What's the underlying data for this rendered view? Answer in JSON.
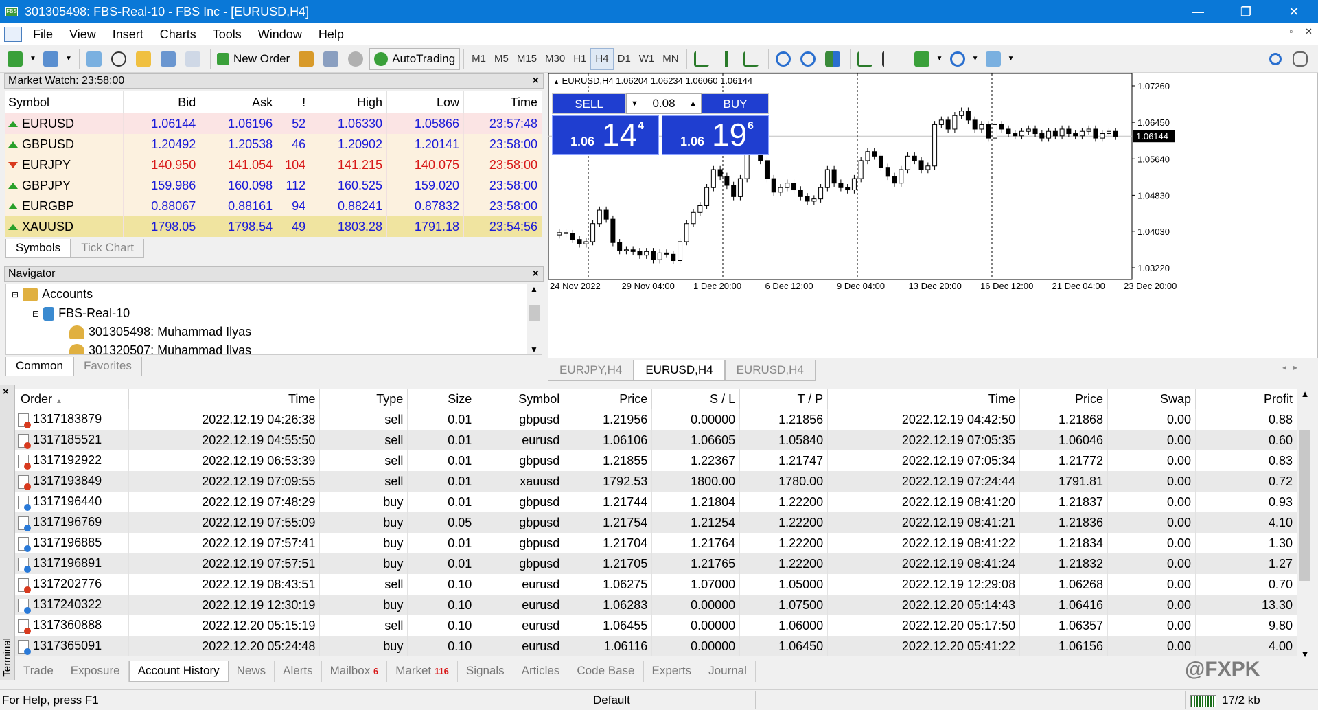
{
  "window": {
    "title": "301305498: FBS-Real-10 - FBS Inc - [EURUSD,H4]",
    "min_icon": "minimize-icon",
    "max_icon": "restore-icon",
    "close_icon": "close-icon",
    "minimize": "—",
    "restore": "❐",
    "close": "✕"
  },
  "menu": {
    "items": [
      "File",
      "View",
      "Insert",
      "Charts",
      "Tools",
      "Window",
      "Help"
    ],
    "mdi": [
      "–",
      "▫",
      "✕"
    ]
  },
  "toolbar": {
    "new_order": "New Order",
    "autotrading": "AutoTrading",
    "timeframes": [
      "M1",
      "M5",
      "M15",
      "M30",
      "H1",
      "H4",
      "D1",
      "W1",
      "MN"
    ],
    "active_timeframe": "H4"
  },
  "market_watch": {
    "title": "Market Watch: 23:58:00",
    "columns": [
      "Symbol",
      "Bid",
      "Ask",
      "!",
      "High",
      "Low",
      "Time"
    ],
    "rows": [
      {
        "symbol": "EURUSD",
        "bid": "1.06144",
        "ask": "1.06196",
        "spread": "52",
        "high": "1.06330",
        "low": "1.05866",
        "time": "23:57:48",
        "dir": "up",
        "bg": "pink"
      },
      {
        "symbol": "GBPUSD",
        "bid": "1.20492",
        "ask": "1.20538",
        "spread": "46",
        "high": "1.20902",
        "low": "1.20141",
        "time": "23:58:00",
        "dir": "up",
        "bg": "cream"
      },
      {
        "symbol": "EURJPY",
        "bid": "140.950",
        "ask": "141.054",
        "spread": "104",
        "high": "141.215",
        "low": "140.075",
        "time": "23:58:00",
        "dir": "down",
        "bg": "cream"
      },
      {
        "symbol": "GBPJPY",
        "bid": "159.986",
        "ask": "160.098",
        "spread": "112",
        "high": "160.525",
        "low": "159.020",
        "time": "23:58:00",
        "dir": "up",
        "bg": "cream"
      },
      {
        "symbol": "EURGBP",
        "bid": "0.88067",
        "ask": "0.88161",
        "spread": "94",
        "high": "0.88241",
        "low": "0.87832",
        "time": "23:58:00",
        "dir": "up",
        "bg": "cream"
      },
      {
        "symbol": "XAUUSD",
        "bid": "1798.05",
        "ask": "1798.54",
        "spread": "49",
        "high": "1803.28",
        "low": "1791.18",
        "time": "23:54:56",
        "dir": "up",
        "bg": "gold"
      }
    ],
    "tabs": [
      "Symbols",
      "Tick Chart"
    ]
  },
  "navigator": {
    "title": "Navigator",
    "accounts": "Accounts",
    "server": "FBS-Real-10",
    "account1": "301305498: Muhammad Ilyas",
    "account2": "301320507: Muhammad Ilyas",
    "tabs": [
      "Common",
      "Favorites"
    ]
  },
  "chart": {
    "header": "EURUSD,H4  1.06204 1.06234 1.06060 1.06144",
    "sell_label": "SELL",
    "buy_label": "BUY",
    "lot": "0.08",
    "sell_prefix": "1.06",
    "sell_big": "14",
    "sell_sup": "4",
    "buy_prefix": "1.06",
    "buy_big": "19",
    "buy_sup": "6",
    "price_labels": [
      "1.07260",
      "1.06450",
      "1.05640",
      "1.04830",
      "1.04030",
      "1.03220"
    ],
    "current_price": "1.06144",
    "date_labels": [
      "24 Nov 2022",
      "29 Nov 04:00",
      "1 Dec 20:00",
      "6 Dec 12:00",
      "9 Dec 04:00",
      "13 Dec 20:00",
      "16 Dec 12:00",
      "21 Dec 04:00",
      "23 Dec 20:00"
    ],
    "tabs": [
      "EURJPY,H4",
      "EURUSD,H4",
      "EURUSD,H4"
    ],
    "active_tab": 1
  },
  "terminal": {
    "side_label": "Terminal",
    "columns": [
      "Order",
      "Time",
      "Type",
      "Size",
      "Symbol",
      "Price",
      "S / L",
      "T / P",
      "Time",
      "Price",
      "Swap",
      "Profit"
    ],
    "rows": [
      [
        "1317183879",
        "2022.12.19 04:26:38",
        "sell",
        "0.01",
        "gbpusd",
        "1.21956",
        "0.00000",
        "1.21856",
        "2022.12.19 04:42:50",
        "1.21868",
        "0.00",
        "0.88"
      ],
      [
        "1317185521",
        "2022.12.19 04:55:50",
        "sell",
        "0.01",
        "eurusd",
        "1.06106",
        "1.06605",
        "1.05840",
        "2022.12.19 07:05:35",
        "1.06046",
        "0.00",
        "0.60"
      ],
      [
        "1317192922",
        "2022.12.19 06:53:39",
        "sell",
        "0.01",
        "gbpusd",
        "1.21855",
        "1.22367",
        "1.21747",
        "2022.12.19 07:05:34",
        "1.21772",
        "0.00",
        "0.83"
      ],
      [
        "1317193849",
        "2022.12.19 07:09:55",
        "sell",
        "0.01",
        "xauusd",
        "1792.53",
        "1800.00",
        "1780.00",
        "2022.12.19 07:24:44",
        "1791.81",
        "0.00",
        "0.72"
      ],
      [
        "1317196440",
        "2022.12.19 07:48:29",
        "buy",
        "0.01",
        "gbpusd",
        "1.21744",
        "1.21804",
        "1.22200",
        "2022.12.19 08:41:20",
        "1.21837",
        "0.00",
        "0.93"
      ],
      [
        "1317196769",
        "2022.12.19 07:55:09",
        "buy",
        "0.05",
        "gbpusd",
        "1.21754",
        "1.21254",
        "1.22200",
        "2022.12.19 08:41:21",
        "1.21836",
        "0.00",
        "4.10"
      ],
      [
        "1317196885",
        "2022.12.19 07:57:41",
        "buy",
        "0.01",
        "gbpusd",
        "1.21704",
        "1.21764",
        "1.22200",
        "2022.12.19 08:41:22",
        "1.21834",
        "0.00",
        "1.30"
      ],
      [
        "1317196891",
        "2022.12.19 07:57:51",
        "buy",
        "0.01",
        "gbpusd",
        "1.21705",
        "1.21765",
        "1.22200",
        "2022.12.19 08:41:24",
        "1.21832",
        "0.00",
        "1.27"
      ],
      [
        "1317202776",
        "2022.12.19 08:43:51",
        "sell",
        "0.10",
        "eurusd",
        "1.06275",
        "1.07000",
        "1.05000",
        "2022.12.19 12:29:08",
        "1.06268",
        "0.00",
        "0.70"
      ],
      [
        "1317240322",
        "2022.12.19 12:30:19",
        "buy",
        "0.10",
        "eurusd",
        "1.06283",
        "0.00000",
        "1.07500",
        "2022.12.20 05:14:43",
        "1.06416",
        "0.00",
        "13.30"
      ],
      [
        "1317360888",
        "2022.12.20 05:15:19",
        "sell",
        "0.10",
        "eurusd",
        "1.06455",
        "0.00000",
        "1.06000",
        "2022.12.20 05:17:50",
        "1.06357",
        "0.00",
        "9.80"
      ],
      [
        "1317365091",
        "2022.12.20 05:24:48",
        "buy",
        "0.10",
        "eurusd",
        "1.06116",
        "0.00000",
        "1.06450",
        "2022.12.20 05:41:22",
        "1.06156",
        "0.00",
        "4.00"
      ]
    ],
    "tabs": [
      {
        "label": "Trade",
        "count": ""
      },
      {
        "label": "Exposure",
        "count": ""
      },
      {
        "label": "Account History",
        "count": ""
      },
      {
        "label": "News",
        "count": ""
      },
      {
        "label": "Alerts",
        "count": ""
      },
      {
        "label": "Mailbox",
        "count": "6"
      },
      {
        "label": "Market",
        "count": "116"
      },
      {
        "label": "Signals",
        "count": ""
      },
      {
        "label": "Articles",
        "count": ""
      },
      {
        "label": "Code Base",
        "count": ""
      },
      {
        "label": "Experts",
        "count": ""
      },
      {
        "label": "Journal",
        "count": ""
      }
    ],
    "active_tab": 2
  },
  "status": {
    "help": "For Help, press F1",
    "profile": "Default",
    "traffic": "17/2 kb"
  },
  "watermark": "@FXPK",
  "colors": {
    "titlebar": "#0a78d7",
    "trade_blue": "#1f3ed0",
    "quote_blue": "#1a1ad8",
    "quote_red": "#d81818",
    "up_arrow": "#2aa02a",
    "down_arrow": "#d83a1e"
  }
}
